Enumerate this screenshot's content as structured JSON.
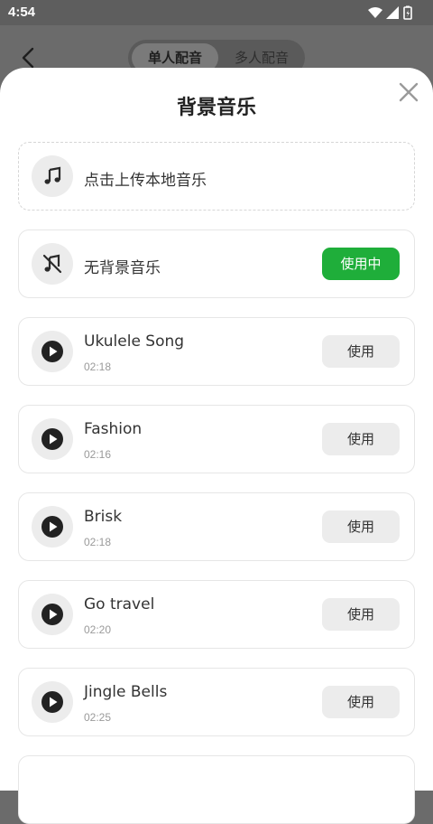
{
  "status_bar": {
    "time": "4:54"
  },
  "header": {
    "tabs": [
      {
        "label": "单人配音",
        "active": true
      },
      {
        "label": "多人配音",
        "active": false
      }
    ]
  },
  "sheet": {
    "title": "背景音乐",
    "upload": {
      "label": "点击上传本地音乐",
      "icon": "music-note-icon"
    },
    "no_music": {
      "label": "无背景音乐",
      "button": "使用中",
      "icon": "music-off-icon"
    },
    "tracks": [
      {
        "name": "Ukulele Song",
        "duration": "02:18",
        "button": "使用"
      },
      {
        "name": "Fashion",
        "duration": "02:16",
        "button": "使用"
      },
      {
        "name": "Brisk",
        "duration": "02:18",
        "button": "使用"
      },
      {
        "name": "Go travel",
        "duration": "02:20",
        "button": "使用"
      },
      {
        "name": "Jingle Bells",
        "duration": "02:25",
        "button": "使用"
      }
    ]
  },
  "colors": {
    "accent_green": "#1fae3a",
    "sheet_bg": "#ffffff",
    "overlay": "#6b6b6b"
  }
}
